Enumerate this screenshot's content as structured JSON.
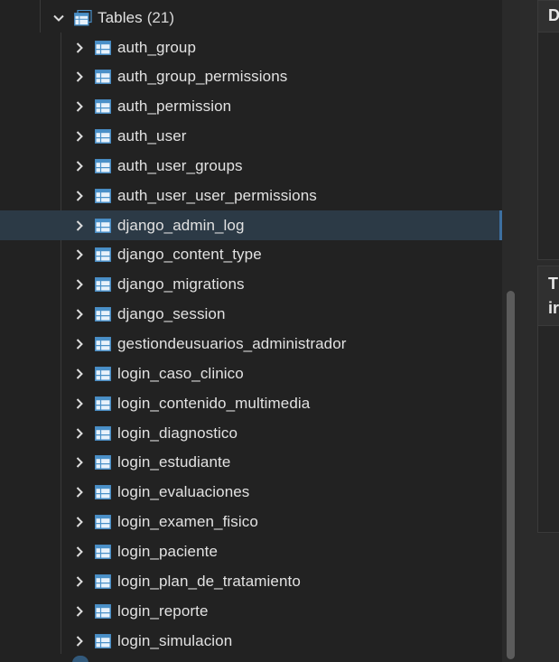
{
  "tree": {
    "tables_label": "Tables",
    "tables_count": "(21)",
    "items": [
      {
        "label": "auth_group"
      },
      {
        "label": "auth_group_permissions"
      },
      {
        "label": "auth_permission"
      },
      {
        "label": "auth_user"
      },
      {
        "label": "auth_user_groups"
      },
      {
        "label": "auth_user_user_permissions"
      },
      {
        "label": "django_admin_log",
        "selected": true
      },
      {
        "label": "django_content_type"
      },
      {
        "label": "django_migrations"
      },
      {
        "label": "django_session"
      },
      {
        "label": "gestiondeusuarios_administrador"
      },
      {
        "label": "login_caso_clinico"
      },
      {
        "label": "login_contenido_multimedia"
      },
      {
        "label": "login_diagnostico"
      },
      {
        "label": "login_estudiante"
      },
      {
        "label": "login_evaluaciones"
      },
      {
        "label": "login_examen_fisico"
      },
      {
        "label": "login_paciente"
      },
      {
        "label": "login_plan_de_tratamiento"
      },
      {
        "label": "login_reporte"
      },
      {
        "label": "login_simulacion"
      }
    ]
  },
  "right_panel": {
    "card1_title": "D",
    "card2_title_line1": "T",
    "card2_title_line2": "ir"
  },
  "colors": {
    "background": "#222222",
    "selected_row": "#2c3a46",
    "selected_accent": "#3d6fa0",
    "table_icon": "#4a90c8",
    "text": "#e2e2e2"
  },
  "icons": {
    "expand": "chevron-right-icon",
    "collapse": "chevron-down-icon",
    "table": "table-icon"
  }
}
